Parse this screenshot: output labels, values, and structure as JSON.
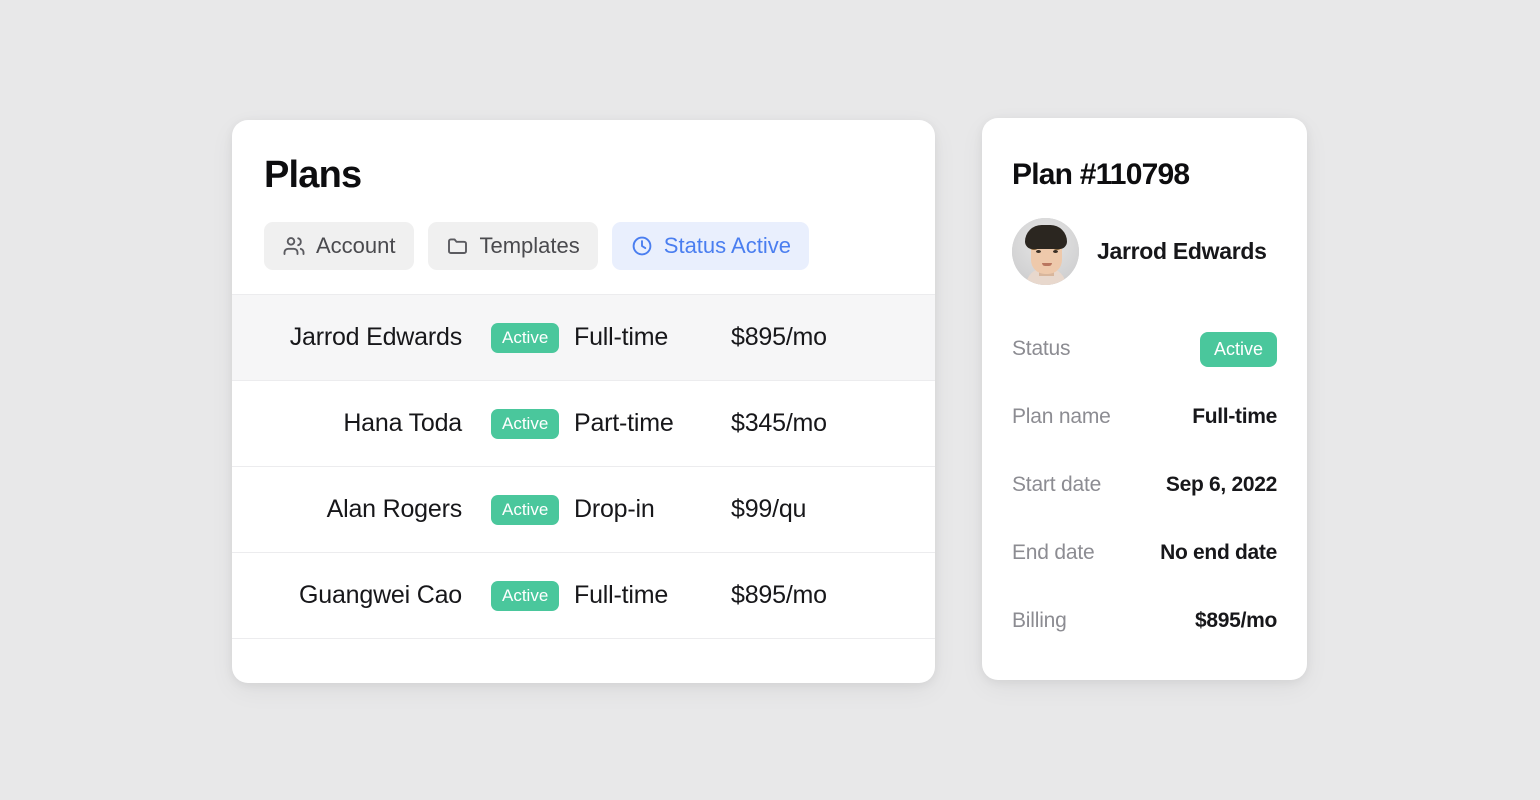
{
  "plans_panel": {
    "title": "Plans",
    "filters": [
      {
        "label": "Account",
        "icon": "users-icon",
        "active": false
      },
      {
        "label": "Templates",
        "icon": "folder-icon",
        "active": false
      },
      {
        "label": "Status Active",
        "icon": "clock-icon",
        "active": true
      }
    ],
    "rows": [
      {
        "name": "Jarrod Edwards",
        "status": "Active",
        "plan": "Full-time",
        "price": "$895/mo",
        "selected": true
      },
      {
        "name": "Hana Toda",
        "status": "Active",
        "plan": "Part-time",
        "price": "$345/mo",
        "selected": false
      },
      {
        "name": "Alan Rogers",
        "status": "Active",
        "plan": "Drop-in",
        "price": "$99/qu",
        "selected": false
      },
      {
        "name": "Guangwei Cao",
        "status": "Active",
        "plan": "Full-time",
        "price": "$895/mo",
        "selected": false
      }
    ]
  },
  "detail_panel": {
    "title": "Plan #110798",
    "person_name": "Jarrod Edwards",
    "avatar_alt": "Jarrod Edwards portrait",
    "fields": [
      {
        "label": "Status",
        "value": "Active",
        "type": "badge"
      },
      {
        "label": "Plan name",
        "value": "Full-time",
        "type": "text"
      },
      {
        "label": "Start date",
        "value": "Sep 6, 2022",
        "type": "text"
      },
      {
        "label": "End date",
        "value": "No end date",
        "type": "text"
      },
      {
        "label": "Billing",
        "value": "$895/mo",
        "type": "text"
      }
    ]
  },
  "colors": {
    "background": "#e8e8e9",
    "card": "#ffffff",
    "status_green": "#4ac79c",
    "accent_blue": "#4a7ef0",
    "accent_blue_bg": "#e9effd",
    "chip_bg": "#f0f0f0",
    "selected_row": "#f6f6f7",
    "label_gray": "#8c8c92",
    "divider": "#ececee"
  }
}
